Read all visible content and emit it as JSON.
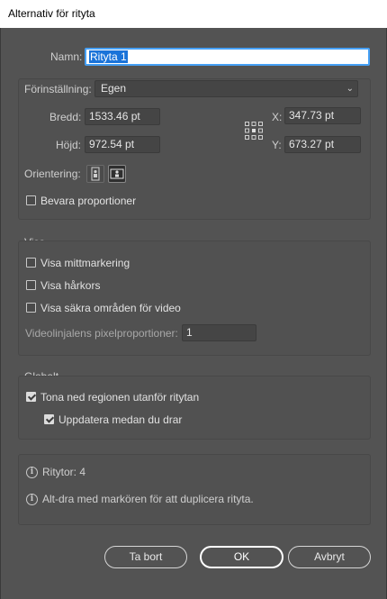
{
  "window": {
    "title": "Alternativ för rityta"
  },
  "name": {
    "label": "Namn:",
    "value": "Rityta 1"
  },
  "preset": {
    "label": "Förinställning:",
    "value": "Egen"
  },
  "dimensions": {
    "width_label": "Bredd:",
    "width_value": "1533.46 pt",
    "height_label": "Höjd:",
    "height_value": "972.54 pt",
    "x_label": "X:",
    "x_value": "347.73 pt",
    "y_label": "Y:",
    "y_value": "673.27 pt"
  },
  "orientation": {
    "label": "Orientering:"
  },
  "constrain": {
    "label": "Bevara proportioner",
    "checked": false
  },
  "display": {
    "title": "Visa",
    "center_mark": {
      "label": "Visa mittmarkering",
      "checked": false
    },
    "cross_hairs": {
      "label": "Visa hårkors",
      "checked": false
    },
    "video_safe": {
      "label": "Visa säkra områden för video",
      "checked": false
    },
    "pixel_ratio_label": "Videolinjalens pixelproportioner:",
    "pixel_ratio_value": "1"
  },
  "global": {
    "title": "Globalt",
    "fade_region": {
      "label": "Tona ned regionen utanför ritytan",
      "checked": true
    },
    "update_drag": {
      "label": "Uppdatera medan du drar",
      "checked": true
    }
  },
  "info": {
    "artboards": "Ritytor: 4",
    "hint": "Alt-dra med markören för att duplicera rityta."
  },
  "buttons": {
    "delete": "Ta bort",
    "ok": "OK",
    "cancel": "Avbryt"
  }
}
